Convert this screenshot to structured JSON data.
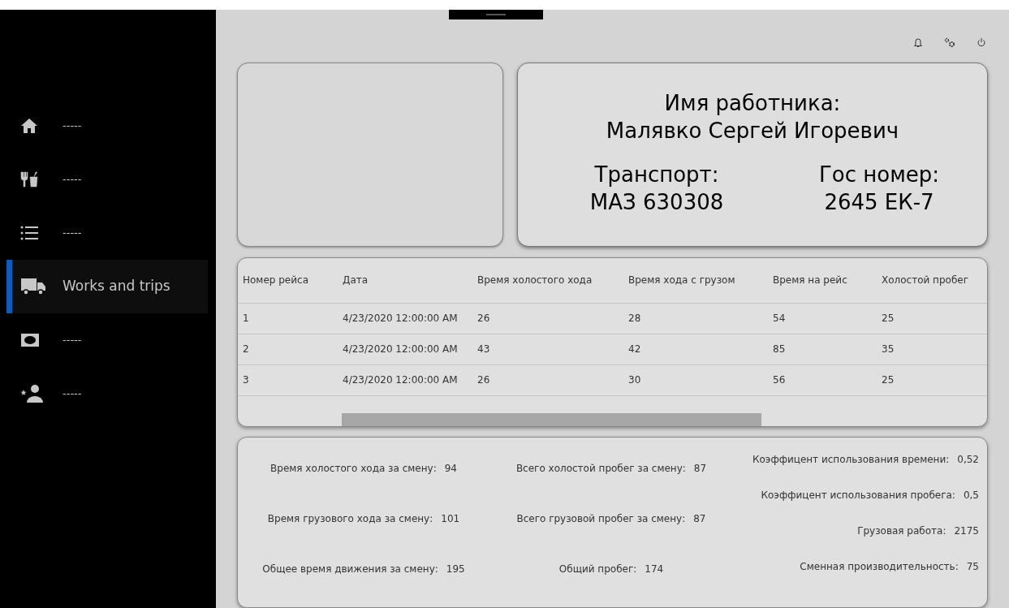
{
  "sidebar": {
    "items": [
      {
        "label": "-----",
        "selected": false
      },
      {
        "label": "-----",
        "selected": false
      },
      {
        "label": "-----",
        "selected": false
      },
      {
        "label": "Works and trips",
        "selected": true
      },
      {
        "label": "-----",
        "selected": false
      },
      {
        "label": "-----",
        "selected": false
      }
    ]
  },
  "worker": {
    "name_label": "Имя работника:",
    "name": "Малявко Сергей Игоревич",
    "transport_label": "Транспорт:",
    "transport": "МАЗ 630308",
    "plate_label": "Гос номер:",
    "plate": "2645 ЕК-7"
  },
  "table": {
    "columns": [
      "Номер рейса",
      "Дата",
      "Время холостого хода",
      "Время хода с грузом",
      "Время на рейс",
      "Холостой пробег"
    ],
    "rows": [
      [
        "1",
        "4/23/2020 12:00:00 AM",
        "26",
        "28",
        "54",
        "25"
      ],
      [
        "2",
        "4/23/2020 12:00:00 AM",
        "43",
        "42",
        "85",
        "35"
      ],
      [
        "3",
        "4/23/2020 12:00:00 AM",
        "26",
        "30",
        "56",
        "25"
      ]
    ]
  },
  "stats": [
    [
      {
        "label": "Время холостого хода за смену:",
        "value": "94"
      },
      {
        "label": "Время грузового хода за смену:",
        "value": "101"
      },
      {
        "label": "Общее время движения за смену:",
        "value": "195"
      }
    ],
    [
      {
        "label": "Всего холостой пробег за смену:",
        "value": "87"
      },
      {
        "label": "Всего грузовой пробег за смену:",
        "value": "87"
      },
      {
        "label": "Общий пробег:",
        "value": "174"
      }
    ],
    [
      {
        "label": "Коэффицент использования времени:",
        "value": "0,52"
      },
      {
        "label": "Коэффицент использования пробега:",
        "value": "0,5"
      },
      {
        "label": "Грузовая работа:",
        "value": "2175"
      },
      {
        "label": "Сменная производительность:",
        "value": "75"
      }
    ]
  ]
}
